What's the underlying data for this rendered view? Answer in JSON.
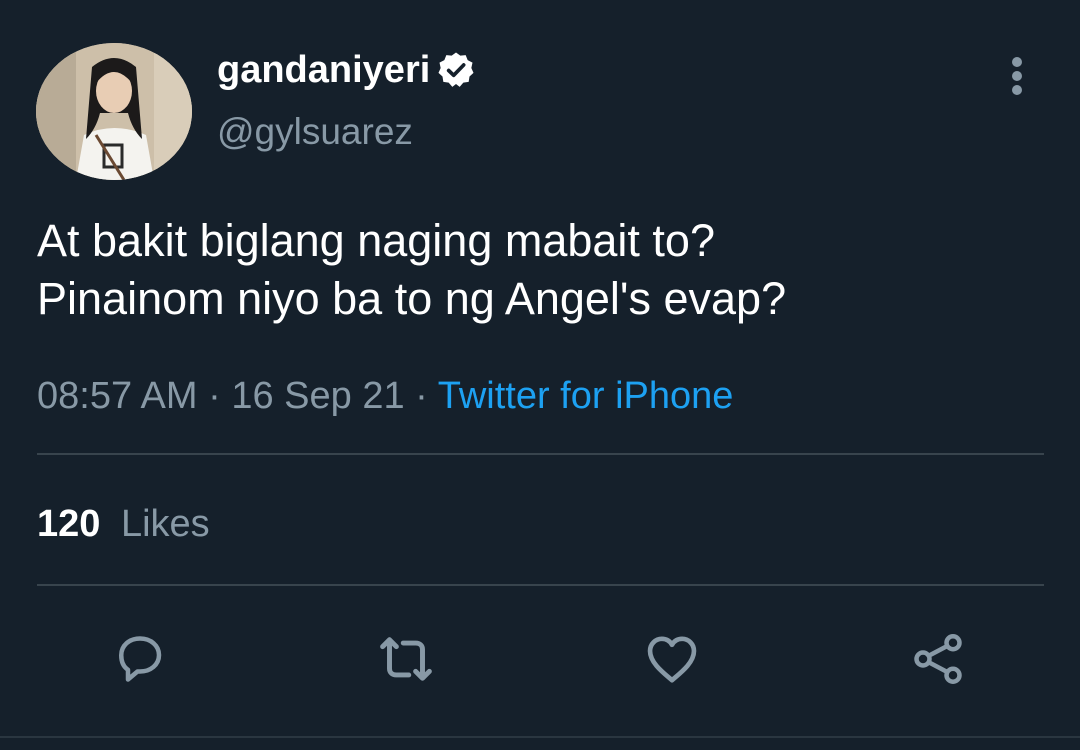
{
  "author": {
    "display_name": "gandaniyeri",
    "handle": "@gylsuarez",
    "verified": true,
    "avatar_icon": "profile-photo"
  },
  "tweet": {
    "text": "At bakit biglang naging mabait to?\nPinainom niyo ba to ng Angel's evap?",
    "time": "08:57 AM",
    "date": "16 Sep 21",
    "separator": "·",
    "source": "Twitter for iPhone"
  },
  "stats": {
    "likes_count": "120",
    "likes_label": "Likes"
  },
  "actions": [
    {
      "icon": "reply-icon"
    },
    {
      "icon": "retweet-icon"
    },
    {
      "icon": "like-icon"
    },
    {
      "icon": "share-icon"
    }
  ],
  "colors": {
    "background": "#15202b",
    "primary_text": "#ffffff",
    "secondary_text": "#8899a6",
    "accent": "#1da1f2",
    "divider": "#38444d"
  }
}
